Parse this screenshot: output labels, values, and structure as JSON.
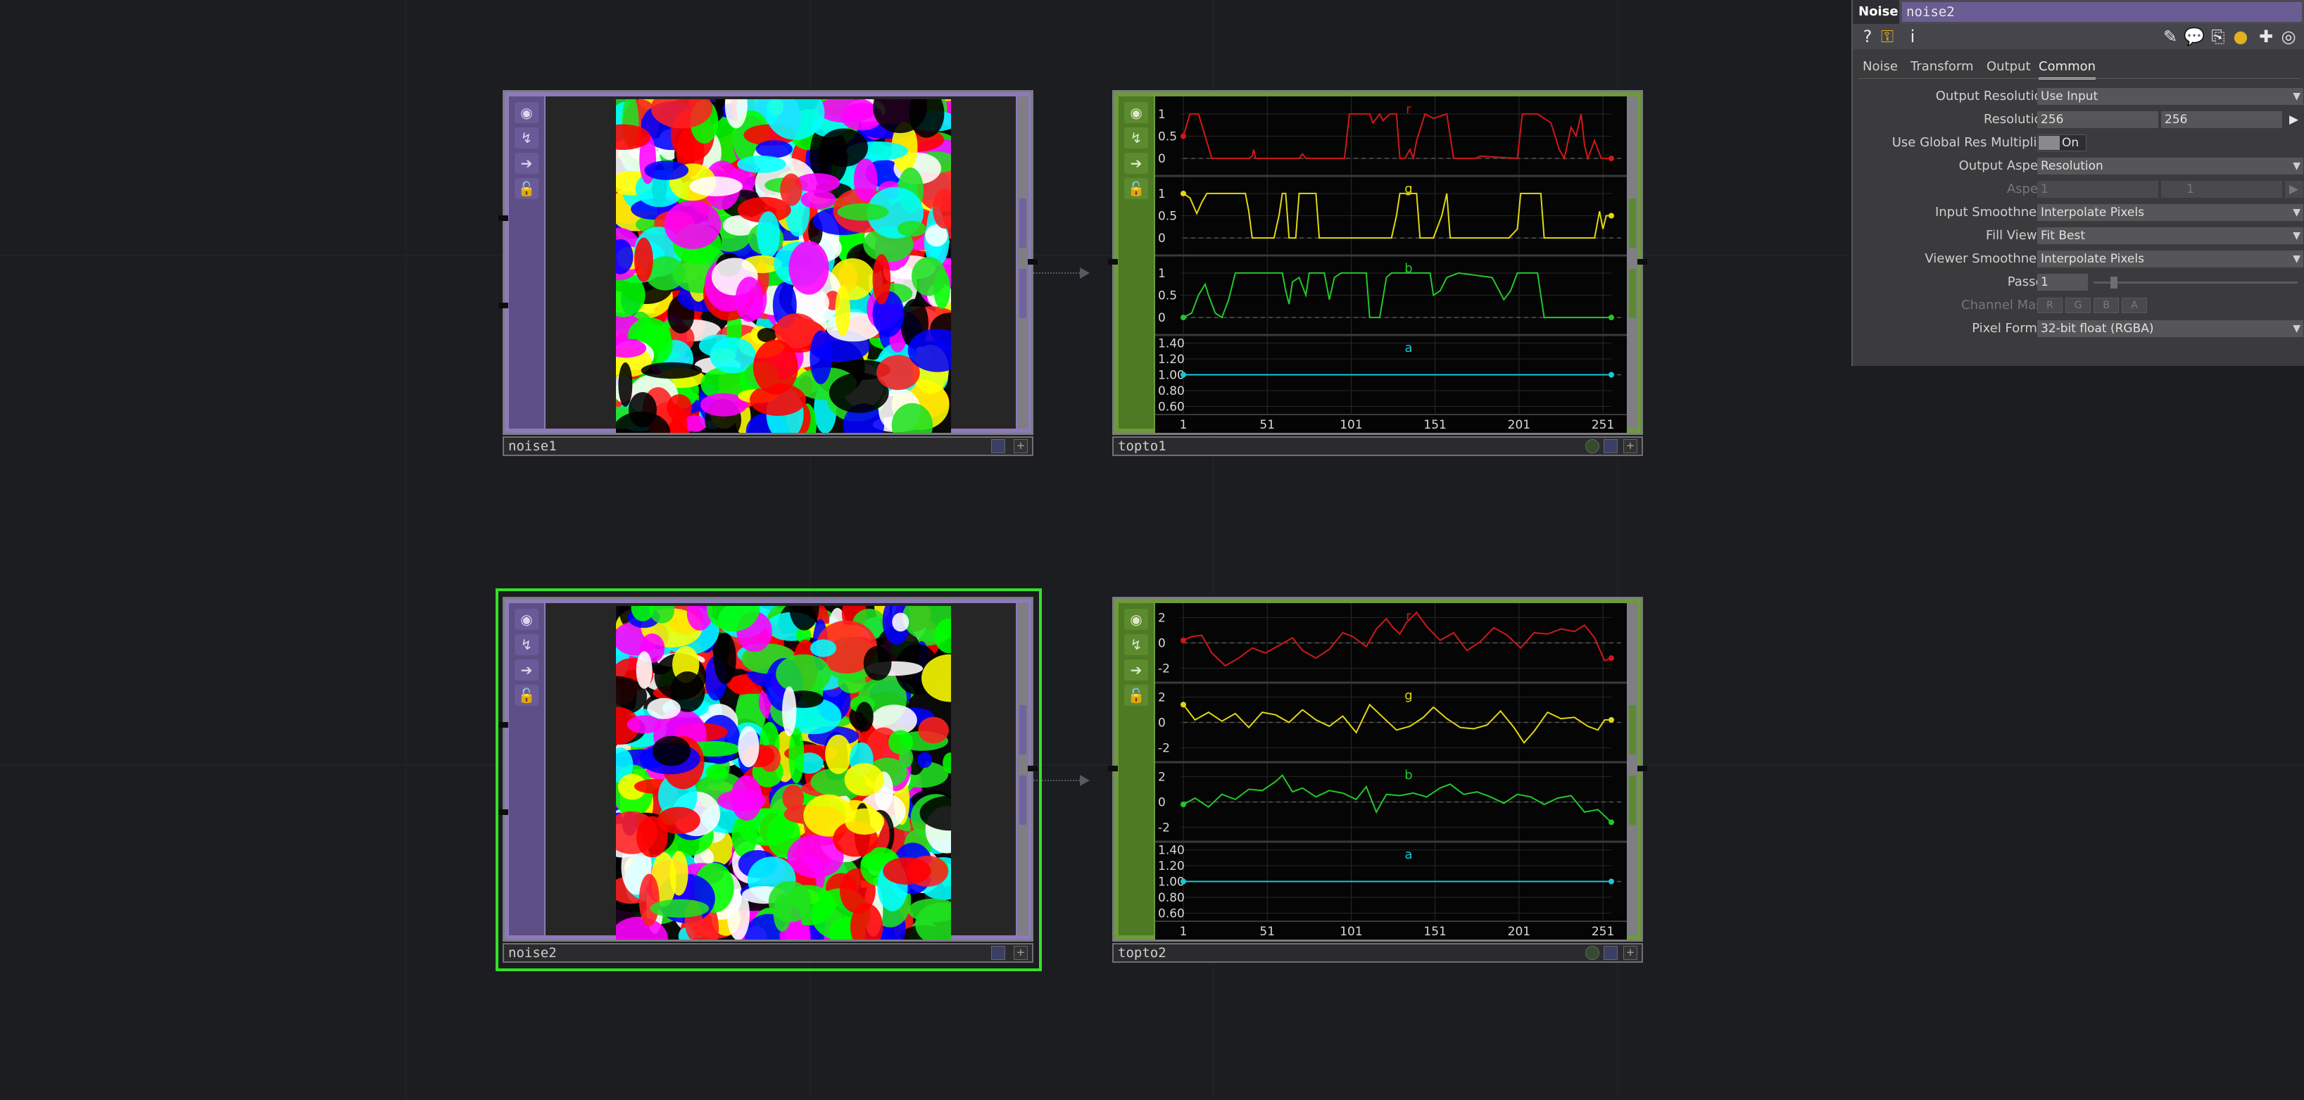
{
  "network": {
    "nodes": [
      {
        "name": "noise1",
        "type": "TOP"
      },
      {
        "name": "topto1",
        "type": "CHOP"
      },
      {
        "name": "noise2",
        "type": "TOP",
        "selected": true
      },
      {
        "name": "topto2",
        "type": "CHOP"
      }
    ]
  },
  "chart_data": [
    {
      "type": "line",
      "node": "topto1",
      "x_ticks": [
        "1",
        "51",
        "101",
        "151",
        "201",
        "251"
      ],
      "xlim": [
        1,
        256
      ],
      "channels": [
        {
          "name": "r",
          "color": "#d01818",
          "ylim": [
            -0.3,
            1.3
          ],
          "ticks": [
            "1",
            "0.5",
            "0"
          ],
          "points": [
            [
              1,
              0.5
            ],
            [
              5,
              1
            ],
            [
              10,
              1
            ],
            [
              18,
              0
            ],
            [
              40,
              0
            ],
            [
              42,
              0.05
            ],
            [
              43,
              0.2
            ],
            [
              44,
              0
            ],
            [
              60,
              0
            ],
            [
              70,
              0
            ],
            [
              72,
              0.1
            ],
            [
              74,
              0
            ],
            [
              97,
              0
            ],
            [
              100,
              1
            ],
            [
              112,
              1
            ],
            [
              114,
              0.8
            ],
            [
              118,
              1
            ],
            [
              120,
              0.85
            ],
            [
              124,
              1
            ],
            [
              128,
              1
            ],
            [
              130,
              0
            ],
            [
              133,
              0
            ],
            [
              136,
              0.2
            ],
            [
              138,
              0
            ],
            [
              140,
              0.4
            ],
            [
              145,
              1
            ],
            [
              150,
              0.9
            ],
            [
              158,
              1
            ],
            [
              162,
              0
            ],
            [
              175,
              0
            ],
            [
              178,
              0.05
            ],
            [
              200,
              0
            ],
            [
              203,
              1
            ],
            [
              212,
              1
            ],
            [
              220,
              0.8
            ],
            [
              225,
              0.2
            ],
            [
              228,
              0
            ],
            [
              232,
              0.7
            ],
            [
              235,
              0.5
            ],
            [
              238,
              1
            ],
            [
              240,
              0.3
            ],
            [
              242,
              0
            ],
            [
              246,
              0.4
            ],
            [
              250,
              0
            ],
            [
              256,
              0
            ]
          ]
        },
        {
          "name": "g",
          "color": "#e0d810",
          "ylim": [
            -0.3,
            1.3
          ],
          "ticks": [
            "1",
            "0.5",
            "0"
          ],
          "points": [
            [
              1,
              1
            ],
            [
              5,
              0.9
            ],
            [
              9,
              0.55
            ],
            [
              12,
              0.8
            ],
            [
              15,
              1
            ],
            [
              38,
              1
            ],
            [
              40,
              0.6
            ],
            [
              42,
              0
            ],
            [
              55,
              0
            ],
            [
              58,
              0.5
            ],
            [
              60,
              1
            ],
            [
              62,
              1
            ],
            [
              64,
              0
            ],
            [
              68,
              0
            ],
            [
              70,
              1
            ],
            [
              80,
              1
            ],
            [
              82,
              0
            ],
            [
              125,
              0
            ],
            [
              128,
              0.5
            ],
            [
              130,
              1
            ],
            [
              140,
              1
            ],
            [
              142,
              0
            ],
            [
              150,
              0
            ],
            [
              155,
              0.5
            ],
            [
              158,
              1
            ],
            [
              160,
              0
            ],
            [
              195,
              0
            ],
            [
              200,
              0.2
            ],
            [
              202,
              1
            ],
            [
              214,
              1
            ],
            [
              216,
              0
            ],
            [
              246,
              0
            ],
            [
              249,
              0.6
            ],
            [
              251,
              0.2
            ],
            [
              253,
              0.5
            ],
            [
              256,
              0.5
            ]
          ]
        },
        {
          "name": "b",
          "color": "#22c82a",
          "ylim": [
            -0.3,
            1.3
          ],
          "ticks": [
            "1",
            "0.5",
            "0"
          ],
          "points": [
            [
              1,
              0
            ],
            [
              6,
              0.1
            ],
            [
              10,
              0.5
            ],
            [
              14,
              0.75
            ],
            [
              16,
              0.5
            ],
            [
              20,
              0.1
            ],
            [
              24,
              0
            ],
            [
              28,
              0.4
            ],
            [
              32,
              1
            ],
            [
              60,
              1
            ],
            [
              62,
              0.6
            ],
            [
              64,
              0.3
            ],
            [
              66,
              0.8
            ],
            [
              70,
              0.9
            ],
            [
              74,
              0.5
            ],
            [
              76,
              1
            ],
            [
              85,
              1
            ],
            [
              88,
              0.4
            ],
            [
              91,
              0.9
            ],
            [
              95,
              1
            ],
            [
              110,
              1
            ],
            [
              112,
              0
            ],
            [
              118,
              0
            ],
            [
              122,
              0.9
            ],
            [
              125,
              1
            ],
            [
              148,
              1
            ],
            [
              150,
              0.5
            ],
            [
              154,
              0.6
            ],
            [
              158,
              0.9
            ],
            [
              165,
              1
            ],
            [
              185,
              0.9
            ],
            [
              192,
              0.4
            ],
            [
              196,
              0.6
            ],
            [
              200,
              1
            ],
            [
              212,
              1
            ],
            [
              216,
              0
            ],
            [
              256,
              0
            ]
          ]
        },
        {
          "name": "a",
          "color": "#18c8d8",
          "ylim": [
            0.55,
            1.45
          ],
          "ticks": [
            "1.40",
            "1.20",
            "1.00",
            "0.80",
            "0.60"
          ],
          "points": [
            [
              1,
              1
            ],
            [
              256,
              1
            ]
          ]
        }
      ]
    },
    {
      "type": "line",
      "node": "topto2",
      "x_ticks": [
        "1",
        "51",
        "101",
        "151",
        "201",
        "251"
      ],
      "xlim": [
        1,
        256
      ],
      "channels": [
        {
          "name": "r",
          "color": "#d01818",
          "ylim": [
            -2.8,
            2.8
          ],
          "ticks": [
            "2",
            "0",
            "-2"
          ],
          "points": [
            [
              1,
              0.2
            ],
            [
              6,
              0.5
            ],
            [
              12,
              0.6
            ],
            [
              18,
              -0.8
            ],
            [
              26,
              -1.8
            ],
            [
              34,
              -1.2
            ],
            [
              42,
              -0.4
            ],
            [
              50,
              -0.8
            ],
            [
              58,
              -0.2
            ],
            [
              66,
              0.4
            ],
            [
              72,
              -0.6
            ],
            [
              80,
              -1.2
            ],
            [
              88,
              -0.5
            ],
            [
              96,
              0.8
            ],
            [
              102,
              0.5
            ],
            [
              110,
              -0.3
            ],
            [
              116,
              1.1
            ],
            [
              122,
              1.9
            ],
            [
              126,
              1.2
            ],
            [
              130,
              0.7
            ],
            [
              134,
              1.6
            ],
            [
              140,
              2.4
            ],
            [
              146,
              1.3
            ],
            [
              154,
              0.2
            ],
            [
              162,
              0.8
            ],
            [
              170,
              -0.6
            ],
            [
              178,
              0.1
            ],
            [
              186,
              1.2
            ],
            [
              194,
              0.6
            ],
            [
              202,
              -0.4
            ],
            [
              210,
              0.8
            ],
            [
              218,
              0.7
            ],
            [
              226,
              1.1
            ],
            [
              234,
              0.9
            ],
            [
              240,
              1.4
            ],
            [
              246,
              0.4
            ],
            [
              252,
              -1.4
            ],
            [
              256,
              -1.2
            ]
          ]
        },
        {
          "name": "g",
          "color": "#e0d810",
          "ylim": [
            -2.8,
            2.8
          ],
          "ticks": [
            "2",
            "0",
            "-2"
          ],
          "points": [
            [
              1,
              1.4
            ],
            [
              8,
              0.2
            ],
            [
              16,
              0.8
            ],
            [
              24,
              0.1
            ],
            [
              32,
              0.7
            ],
            [
              40,
              -0.4
            ],
            [
              48,
              0.8
            ],
            [
              56,
              0.6
            ],
            [
              64,
              0
            ],
            [
              72,
              1
            ],
            [
              80,
              0.2
            ],
            [
              88,
              -0.3
            ],
            [
              96,
              0.5
            ],
            [
              104,
              -0.8
            ],
            [
              112,
              1.4
            ],
            [
              120,
              0.4
            ],
            [
              128,
              -0.6
            ],
            [
              136,
              -0.3
            ],
            [
              144,
              0.4
            ],
            [
              150,
              1.2
            ],
            [
              158,
              0.3
            ],
            [
              166,
              -0.4
            ],
            [
              174,
              -0.5
            ],
            [
              182,
              -0.2
            ],
            [
              190,
              0.9
            ],
            [
              198,
              -0.4
            ],
            [
              204,
              -1.6
            ],
            [
              210,
              -0.7
            ],
            [
              218,
              0.8
            ],
            [
              226,
              0.3
            ],
            [
              234,
              0.4
            ],
            [
              242,
              -0.3
            ],
            [
              248,
              -0.6
            ],
            [
              252,
              0.2
            ],
            [
              256,
              0.2
            ]
          ]
        },
        {
          "name": "b",
          "color": "#22c82a",
          "ylim": [
            -2.8,
            2.8
          ],
          "ticks": [
            "2",
            "0",
            "-2"
          ],
          "points": [
            [
              1,
              -0.2
            ],
            [
              8,
              0.3
            ],
            [
              16,
              -0.4
            ],
            [
              24,
              0.6
            ],
            [
              32,
              0.2
            ],
            [
              40,
              1
            ],
            [
              48,
              0.9
            ],
            [
              56,
              1.6
            ],
            [
              60,
              2.1
            ],
            [
              66,
              0.8
            ],
            [
              72,
              1.1
            ],
            [
              80,
              0.4
            ],
            [
              88,
              0.9
            ],
            [
              96,
              0.7
            ],
            [
              104,
              0.2
            ],
            [
              110,
              1.2
            ],
            [
              116,
              -0.8
            ],
            [
              122,
              0.6
            ],
            [
              130,
              0.5
            ],
            [
              138,
              0.7
            ],
            [
              146,
              0.4
            ],
            [
              154,
              1.1
            ],
            [
              160,
              1.4
            ],
            [
              168,
              0.6
            ],
            [
              176,
              0.8
            ],
            [
              184,
              0.4
            ],
            [
              192,
              -0.1
            ],
            [
              200,
              0.6
            ],
            [
              208,
              0.4
            ],
            [
              216,
              -0.2
            ],
            [
              224,
              0.3
            ],
            [
              232,
              0.5
            ],
            [
              240,
              -0.8
            ],
            [
              248,
              -0.6
            ],
            [
              256,
              -1.6
            ]
          ]
        },
        {
          "name": "a",
          "color": "#18c8d8",
          "ylim": [
            0.55,
            1.45
          ],
          "ticks": [
            "1.40",
            "1.20",
            "1.00",
            "0.80",
            "0.60"
          ],
          "points": [
            [
              1,
              1
            ],
            [
              256,
              1
            ]
          ]
        }
      ]
    }
  ],
  "param_panel": {
    "op_type": "Noise",
    "op_name": "noise2",
    "toolbar_icons": [
      "help-icon",
      "python-help-icon",
      "info-icon",
      "edit-icon",
      "comment-icon",
      "clone-icon",
      "python-icon",
      "add-icon",
      "viewer-icon"
    ],
    "tool_glyphs": [
      "?",
      "⚿",
      "i",
      "✎",
      "💬",
      "⎘",
      "●",
      "✚",
      "◎"
    ],
    "tabs": [
      "Noise",
      "Transform",
      "Output",
      "Common"
    ],
    "active_tab": "Common",
    "params": {
      "output_resolution": {
        "label": "Output Resolution",
        "value": "Use Input"
      },
      "resolution": {
        "label": "Resolution",
        "w": "256",
        "h": "256",
        "arrow": "▶"
      },
      "use_global_res_multiplier": {
        "label": "Use Global Res Multiplier",
        "value": "On"
      },
      "output_aspect": {
        "label": "Output Aspect",
        "value": "Resolution"
      },
      "aspect": {
        "label": "Aspect",
        "w": "1",
        "h": "1",
        "arrow": "▶"
      },
      "input_smoothness": {
        "label": "Input Smoothness",
        "value": "Interpolate Pixels"
      },
      "fill_viewer": {
        "label": "Fill Viewer",
        "value": "Fit Best"
      },
      "viewer_smoothness": {
        "label": "Viewer Smoothness",
        "value": "Interpolate Pixels"
      },
      "passes": {
        "label": "Passes",
        "value": "1"
      },
      "channel_mask": {
        "label": "Channel Mask",
        "buttons": [
          "R",
          "G",
          "B",
          "A"
        ]
      },
      "pixel_format": {
        "label": "Pixel Format",
        "value": "32-bit float (RGBA)"
      }
    }
  },
  "colors": {
    "top_node": "#8d7ab8",
    "chop_node": "#6e9a3c",
    "selection": "#35e027",
    "background": "#1b1d20"
  }
}
